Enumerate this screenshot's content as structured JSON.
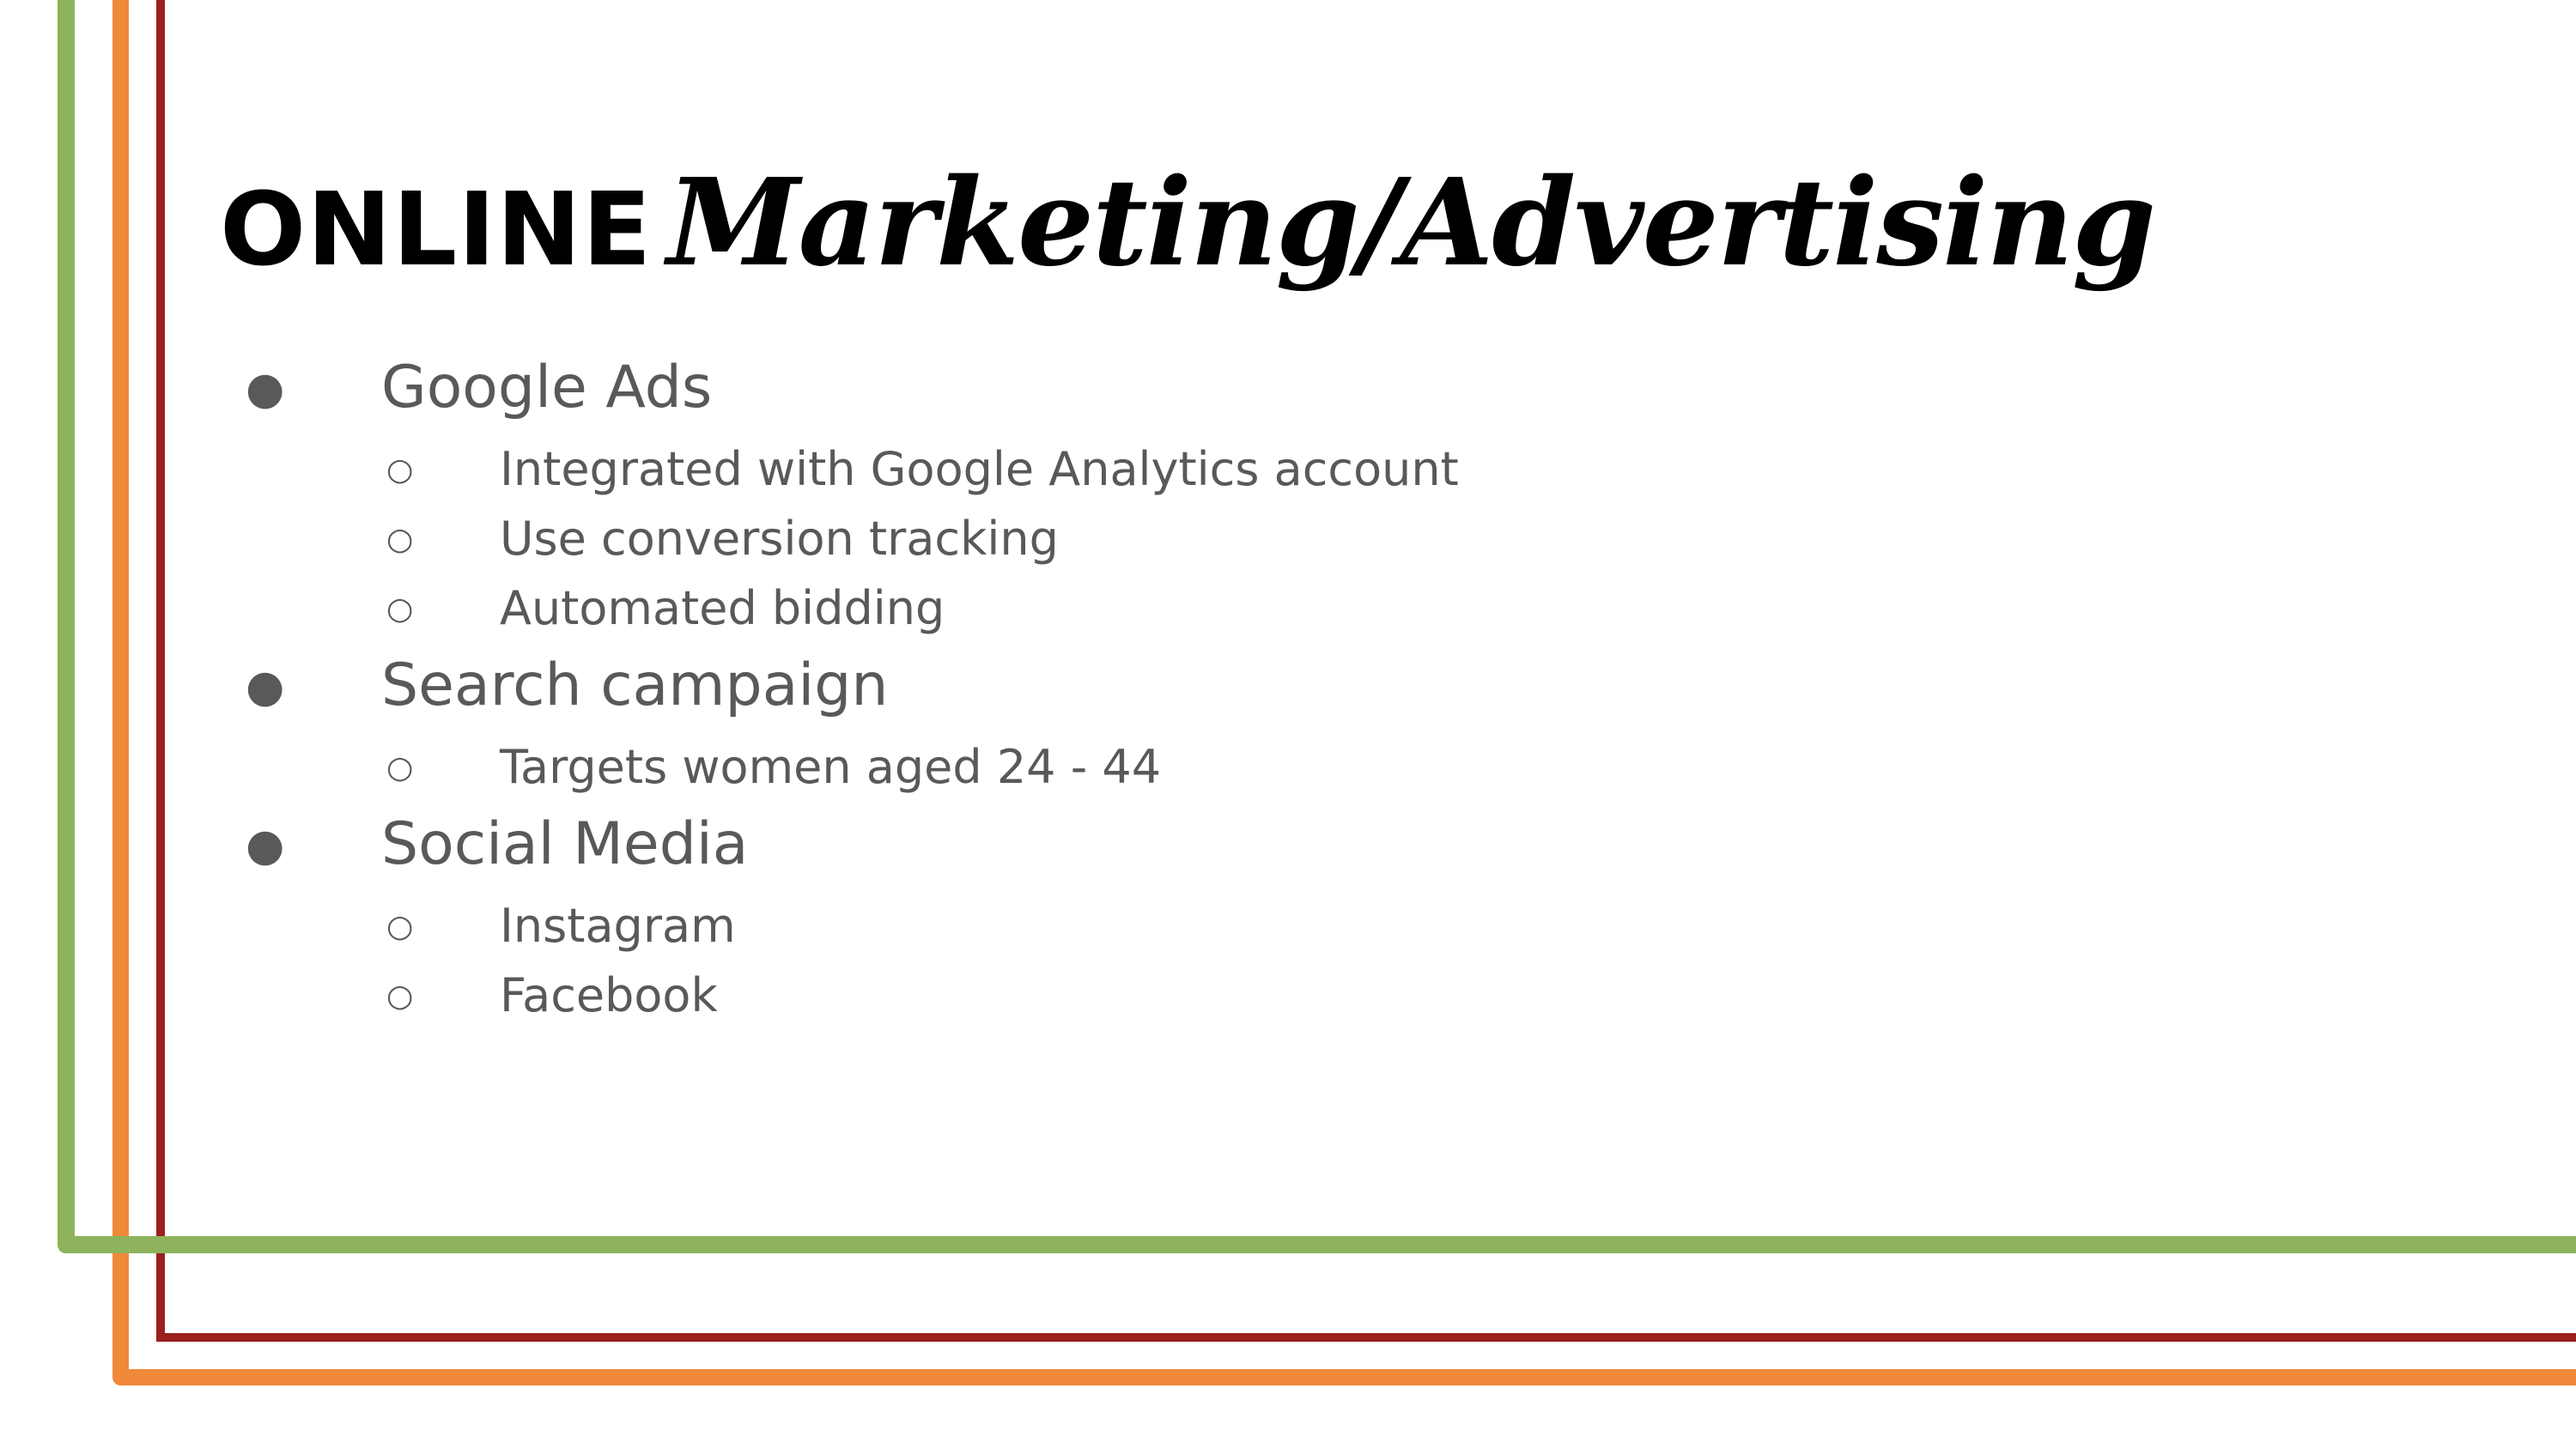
{
  "slide": {
    "colors": {
      "green": "#8db35c",
      "orange": "#f0883a",
      "red": "#9b1f1f",
      "text": "#595959",
      "title": "#000000"
    },
    "title": {
      "plain": "ONLINE",
      "script": "Marketing/Advertising"
    },
    "bullets": [
      {
        "text": "Google Ads",
        "subitems": [
          "Integrated with Google Analytics account",
          "Use conversion tracking",
          "Automated bidding"
        ]
      },
      {
        "text": "Search campaign",
        "subitems": [
          "Targets women aged 24 - 44"
        ]
      },
      {
        "text": "Social Media",
        "subitems": [
          "Instagram",
          "Facebook"
        ]
      }
    ],
    "bullet_glyphs": {
      "level1": "●",
      "level2": "○"
    }
  }
}
